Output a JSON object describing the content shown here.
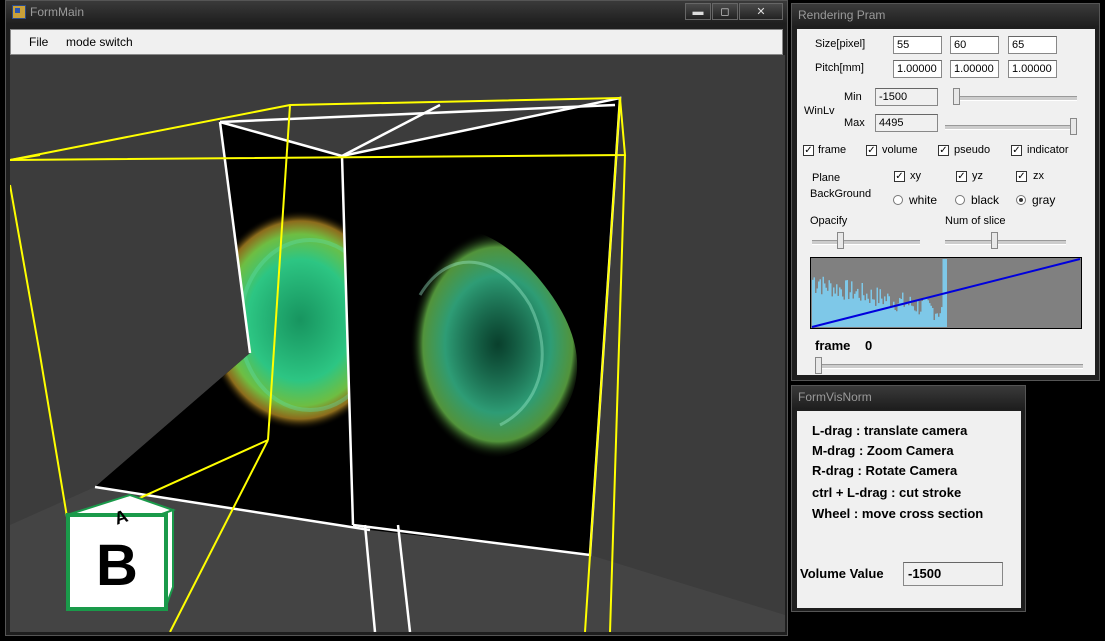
{
  "form_main": {
    "title": "FormMain",
    "caption": {
      "minimize": "▬",
      "maximize": "◻",
      "close": "✕"
    },
    "menu": [
      "File",
      "mode switch"
    ]
  },
  "cube_letters": {
    "front": "B",
    "top": "A"
  },
  "rendering_pram": {
    "title": "Rendering Pram",
    "size_label": "Size[pixel]",
    "size": [
      "55",
      "60",
      "65"
    ],
    "pitch_label": "Pitch[mm]",
    "pitch": [
      "1.00000",
      "1.00000",
      "1.00000"
    ],
    "winlv_label": "WinLv",
    "min_label": "Min",
    "min_value": "-1500",
    "max_label": "Max",
    "max_value": "4495",
    "min_slider": 0.0,
    "max_slider": 1.0,
    "checkboxes": [
      {
        "label": "frame",
        "checked": true
      },
      {
        "label": "volume",
        "checked": true
      },
      {
        "label": "pseudo",
        "checked": true
      },
      {
        "label": "indicator",
        "checked": true
      }
    ],
    "plane_label": "Plane",
    "planes": [
      {
        "label": "xy",
        "checked": true
      },
      {
        "label": "yz",
        "checked": true
      },
      {
        "label": "zx",
        "checked": true
      }
    ],
    "background_label": "BackGround",
    "backgrounds": [
      {
        "label": "white",
        "selected": false
      },
      {
        "label": "black",
        "selected": false
      },
      {
        "label": "gray",
        "selected": true
      }
    ],
    "opacity_label": "Opacify",
    "opacity_slider": 0.25,
    "num_slice_label": "Num of slice",
    "num_slice_slider": 0.4,
    "frame_label": "frame",
    "frame_value": "0",
    "frame_slider": 0.0
  },
  "vis_norm": {
    "title": "FormVisNorm",
    "help": [
      "L-drag : translate camera",
      "M-drag : Zoom Camera",
      "R-drag : Rotate Camera",
      "ctrl + L-drag : cut stroke",
      "Wheel : move cross section"
    ],
    "volume_label": "Volume Value",
    "volume_value": "-1500"
  },
  "colors": {
    "frame": "#ffff00",
    "transfer_line": "#0000dd",
    "histogram": "#7ec8e8"
  }
}
